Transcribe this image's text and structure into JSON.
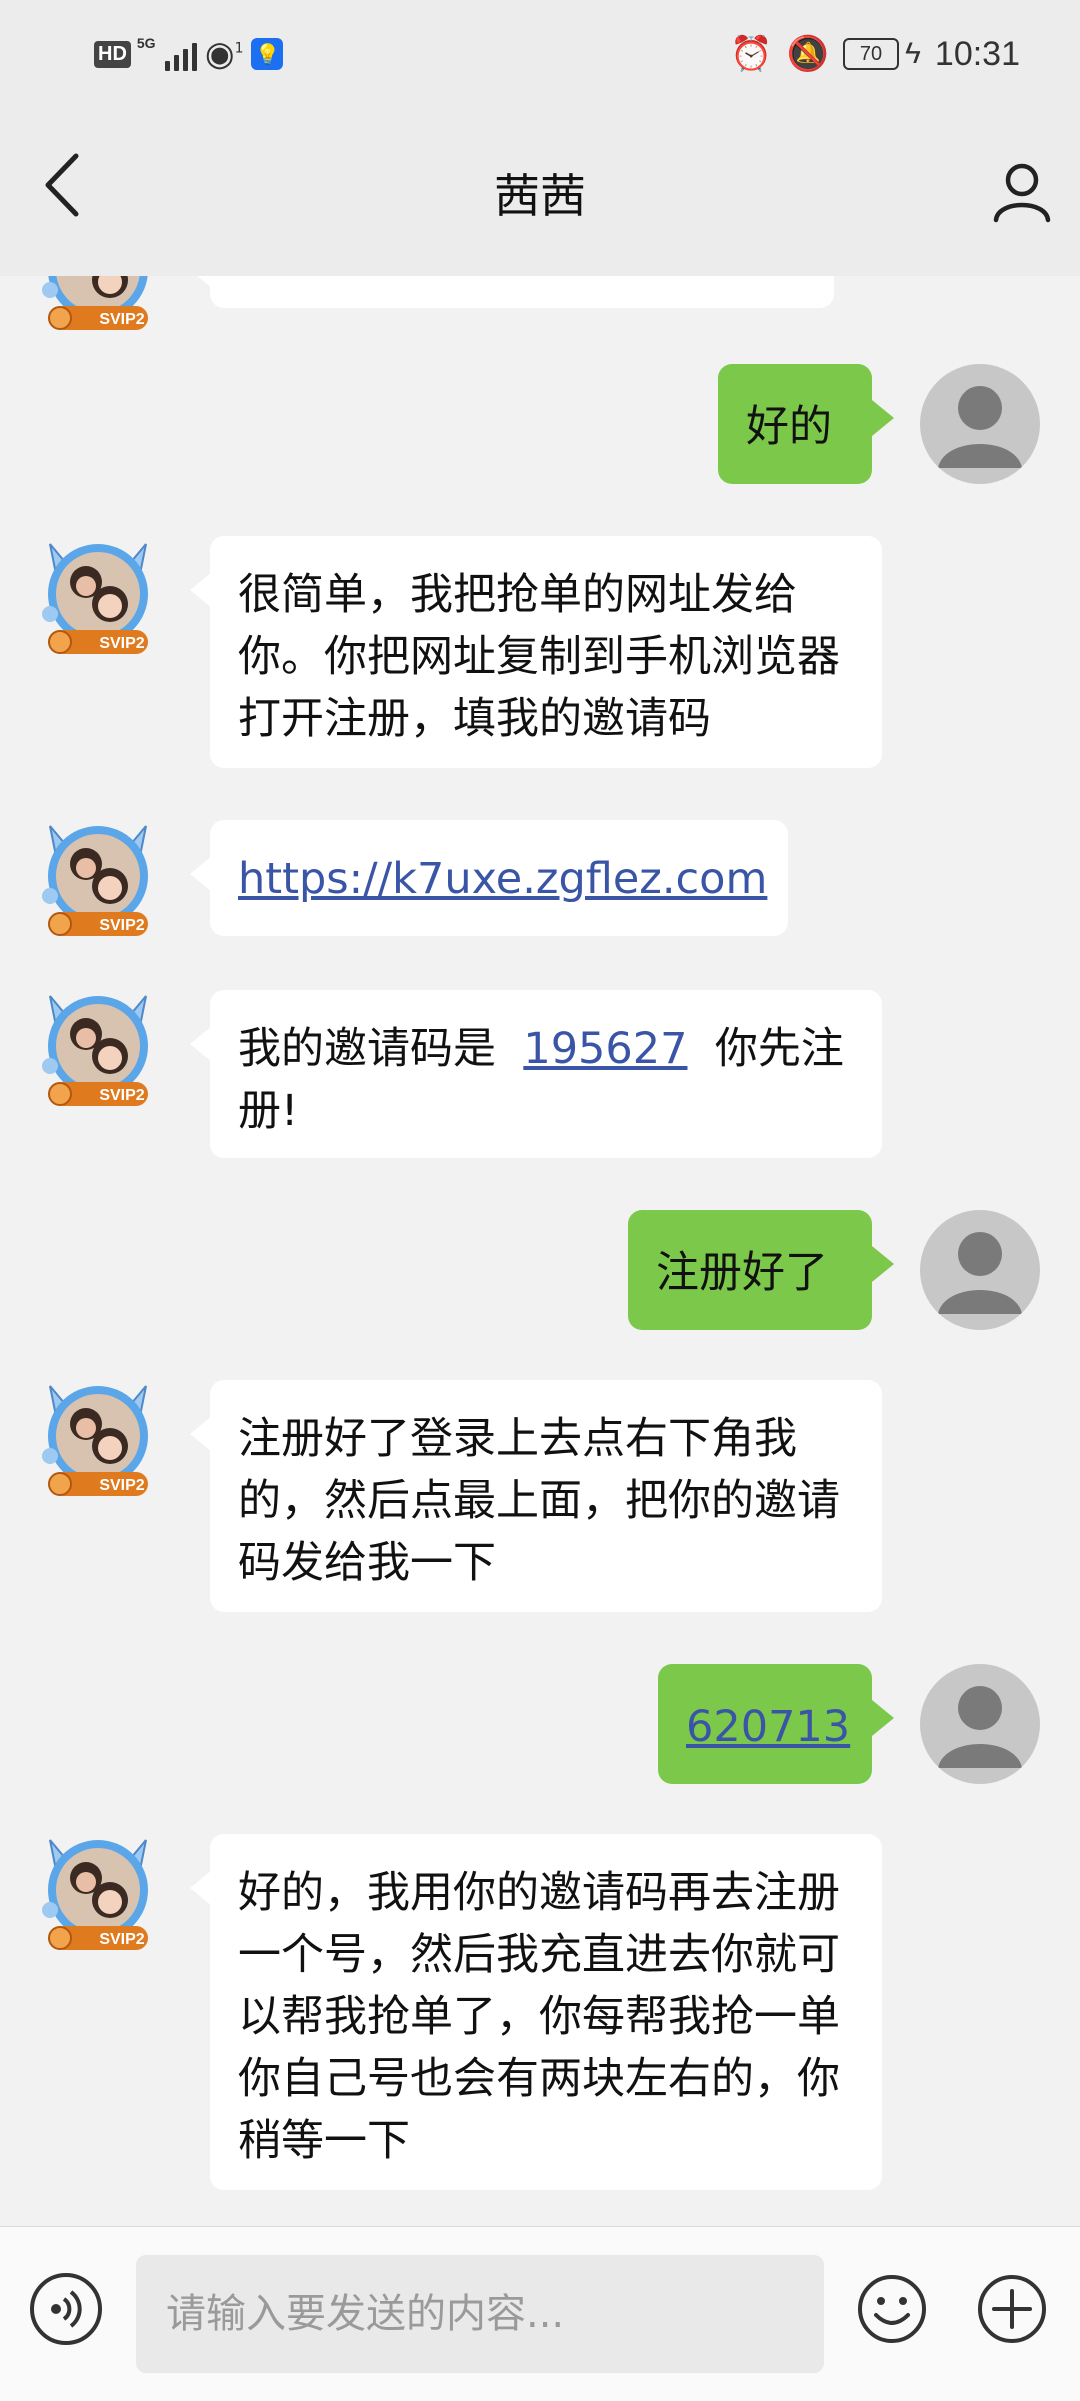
{
  "status_bar": {
    "hd": "HD",
    "net": "5G",
    "wifi_sup": "1",
    "battery": "70",
    "time": "10:31"
  },
  "header": {
    "title": "茜茜"
  },
  "chat": {
    "messages": [
      {
        "side": "in",
        "text": ""
      },
      {
        "side": "out",
        "text": "好的"
      },
      {
        "side": "in",
        "text": "很简单，我把抢单的网址发给你。你把网址复制到手机浏览器打开注册，填我的邀请码"
      },
      {
        "side": "in",
        "link": "https://k7uxe.zgflez.com"
      },
      {
        "side": "in",
        "prefix": "我的邀请码是",
        "link": "195627",
        "suffix": "你先注册!"
      },
      {
        "side": "out",
        "text": "注册好了"
      },
      {
        "side": "in",
        "text": "注册好了登录上去点右下角我的，然后点最上面，把你的邀请码发给我一下"
      },
      {
        "side": "out",
        "link": "620713"
      },
      {
        "side": "in",
        "text": "好的，我用你的邀请码再去注册一个号，然后我充直进去你就可以帮我抢单了，你每帮我抢一单你自己号也会有两块左右的，你稍等一下"
      }
    ],
    "badge": "SVIP2"
  },
  "input_bar": {
    "placeholder": "请输入要发送的内容..."
  },
  "colors": {
    "out_bubble": "#7cc84a",
    "link": "#3a55a6",
    "badge": "#e07a1f"
  }
}
